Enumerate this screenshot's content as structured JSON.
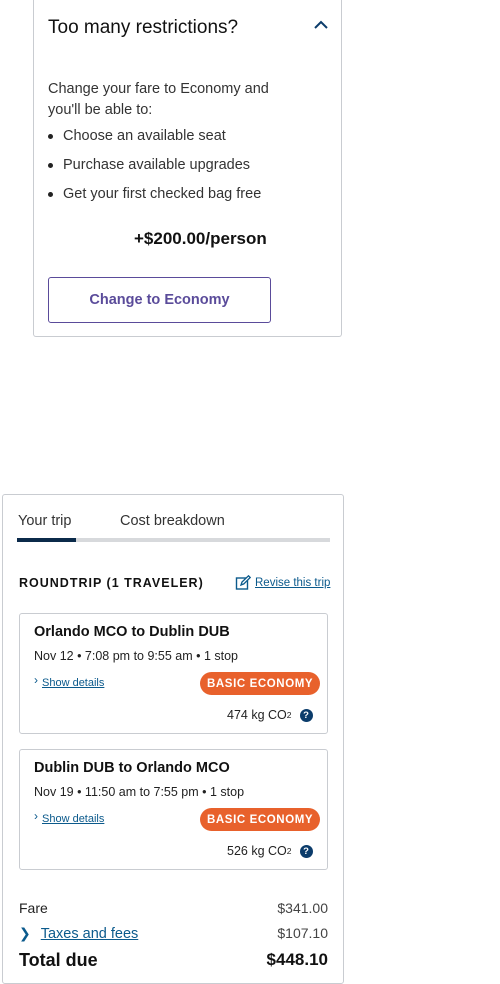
{
  "upsell": {
    "title": "Too many restrictions?",
    "lead": "Change your fare to Economy and you'll be able to:",
    "bullets": [
      "Choose an available seat",
      "Purchase available upgrades",
      "Get your first checked bag free"
    ],
    "price": "+$200.00/person",
    "button_label": "Change to Economy"
  },
  "summary": {
    "tabs": [
      "Your trip",
      "Cost breakdown"
    ],
    "active_tab": "Your trip",
    "trip_type": "ROUNDTRIP (1 TRAVELER)",
    "revise_label": "Revise this trip",
    "segments": [
      {
        "route": "Orlando MCO to Dublin DUB",
        "times": "Nov 12 • 7:08 pm to 9:55 am • 1 stop",
        "details_label": "Show details",
        "fare_badge": "BASIC ECONOMY",
        "co2_value": "474 kg CO",
        "co2_subscript": "2"
      },
      {
        "route": "Dublin DUB to Orlando MCO",
        "times": "Nov 19 • 11:50 am to 7:55 pm • 1 stop",
        "details_label": "Show details",
        "fare_badge": "BASIC ECONOMY",
        "co2_value": "526 kg CO",
        "co2_subscript": "2"
      }
    ],
    "costs": {
      "fare_label": "Fare",
      "fare_value": "$341.00",
      "taxes_label": "Taxes and fees",
      "taxes_value": "$107.10",
      "total_label": "Total due",
      "total_value": "$448.10"
    }
  },
  "colors": {
    "accent_purple": "#5a4b9a",
    "badge_orange": "#e8612c",
    "link_blue": "#0b5a8c",
    "tab_active": "#0b2a4a"
  }
}
